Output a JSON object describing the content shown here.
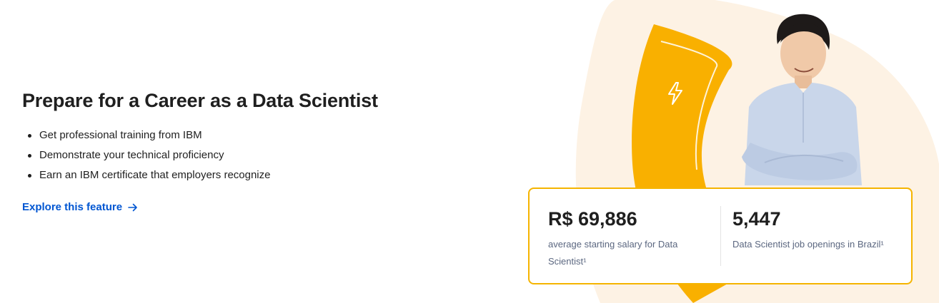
{
  "feature": {
    "title": "Prepare for a Career as a Data Scientist",
    "bullets": [
      "Get professional training from IBM",
      "Demonstrate your technical proficiency",
      "Earn an IBM certificate that employers recognize"
    ],
    "explore_label": "Explore this feature"
  },
  "stats": [
    {
      "value": "R$ 69,886",
      "desc": "average starting salary for Data Scientist¹"
    },
    {
      "value": "5,447",
      "desc": "Data Scientist job openings in Brazil¹"
    }
  ],
  "colors": {
    "accent": "#f9b000",
    "link": "#0056d2",
    "background_blob": "#fdf2e4",
    "card_border": "#f5b400"
  },
  "icons": {
    "bolt": "lightning-bolt-icon",
    "arrow": "arrow-right-icon"
  }
}
